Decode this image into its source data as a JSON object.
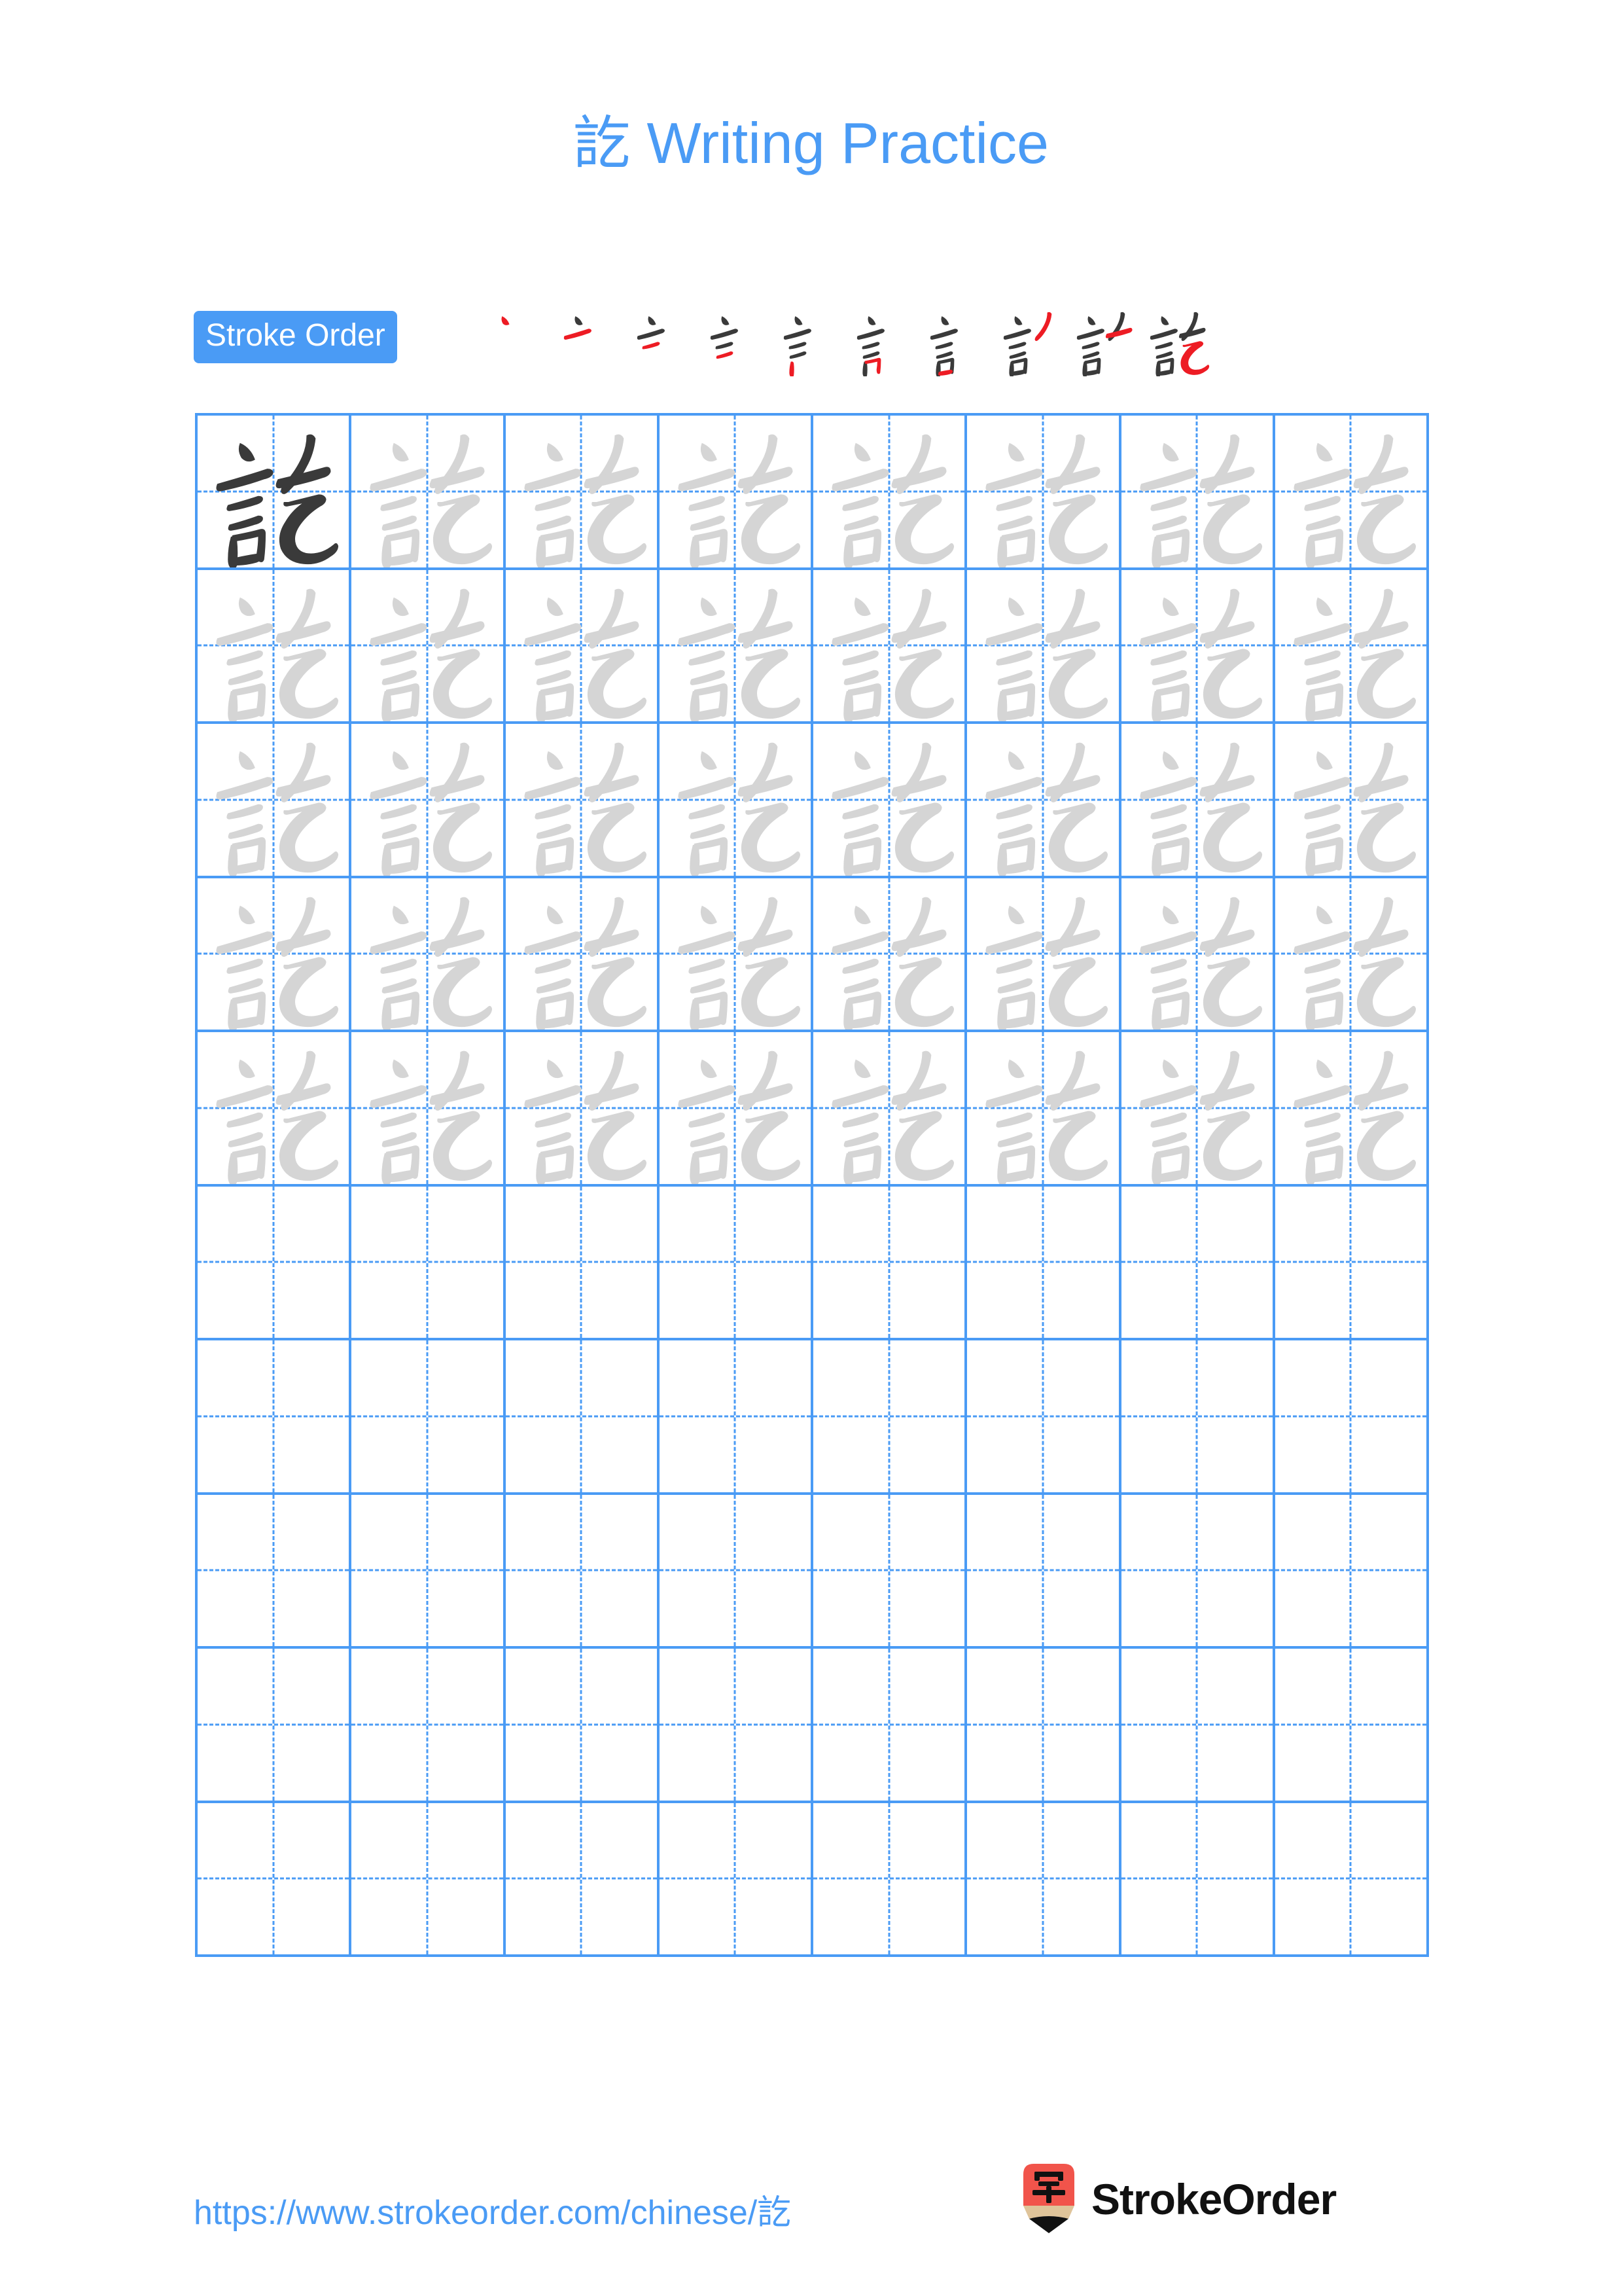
{
  "page": {
    "character": "訖",
    "title_suffix": " Writing Practice",
    "background_color": "#ffffff",
    "accent_color": "#4a9bf5",
    "ink_color": "#3a3a3a",
    "ghost_color": "#d5d5d5",
    "highlight_color": "#ed1c24"
  },
  "header": {
    "title": "訖 Writing Practice"
  },
  "stroke_order": {
    "badge_label": "Stroke Order",
    "total_strokes": 10,
    "steps": [
      {
        "index": 1,
        "new_stroke": "dot",
        "strokes_shown": 1
      },
      {
        "index": 2,
        "new_stroke": "horizontal",
        "strokes_shown": 2
      },
      {
        "index": 3,
        "new_stroke": "horizontal",
        "strokes_shown": 3
      },
      {
        "index": 4,
        "new_stroke": "horizontal",
        "strokes_shown": 4
      },
      {
        "index": 5,
        "new_stroke": "vertical",
        "strokes_shown": 5
      },
      {
        "index": 6,
        "new_stroke": "horizontal-fold",
        "strokes_shown": 6
      },
      {
        "index": 7,
        "new_stroke": "horizontal",
        "strokes_shown": 7
      },
      {
        "index": 8,
        "new_stroke": "left-falling",
        "strokes_shown": 8
      },
      {
        "index": 9,
        "new_stroke": "horizontal",
        "strokes_shown": 9
      },
      {
        "index": 10,
        "new_stroke": "horizontal-bend-hook",
        "strokes_shown": 10
      }
    ]
  },
  "practice_grid": {
    "columns": 8,
    "rows": 10,
    "filled_rows": 5,
    "empty_rows": 5,
    "first_cell_style": "ink",
    "traced_cell_style": "ghost",
    "cell_guides": "dashed-crosshair"
  },
  "footer": {
    "url": "https://www.strokeorder.com/chinese/訖",
    "brand_name": "StrokeOrder",
    "logo_character": "字",
    "logo_body_color": "#f1544b",
    "logo_wood_color": "#dfc49a",
    "logo_tip_color": "#111111"
  }
}
